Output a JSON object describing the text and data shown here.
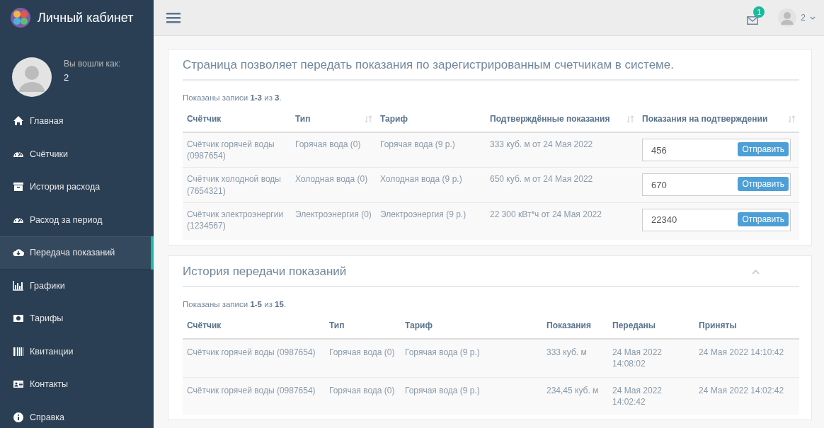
{
  "sidebar": {
    "title": "Личный кабинет",
    "profile": {
      "greeting": "Вы вошли как:",
      "user": "2"
    },
    "items": [
      {
        "label": "Главная",
        "kind": "home",
        "selected": false
      },
      {
        "label": "Счётчики",
        "kind": "gauge",
        "selected": false
      },
      {
        "label": "История расхода",
        "kind": "archive",
        "selected": false
      },
      {
        "label": "Расход за период",
        "kind": "gauge",
        "selected": false
      },
      {
        "label": "Передача показаний",
        "kind": "cloud",
        "selected": true
      },
      {
        "label": "Графики",
        "kind": "chart",
        "selected": false
      },
      {
        "label": "Тарифы",
        "kind": "money",
        "selected": false
      },
      {
        "label": "Квитанции",
        "kind": "barcode",
        "selected": false
      },
      {
        "label": "Контакты",
        "kind": "card",
        "selected": false
      },
      {
        "label": "Справка",
        "kind": "info",
        "selected": false
      }
    ]
  },
  "topbar": {
    "mail_count": "1",
    "user": "2"
  },
  "readings_panel": {
    "title": "Страница позволяет передать показания по зарегистрированным счетчикам в системе.",
    "summary": "Показаны записи **1-3** из **3**.",
    "columns": [
      {
        "label": "Счётчик",
        "sortable": false
      },
      {
        "label": "Тип",
        "sortable": true
      },
      {
        "label": "Тариф",
        "sortable": false
      },
      {
        "label": "Подтверждённые показания",
        "sortable": true
      },
      {
        "label": "Показания на подтверждении",
        "sortable": true
      }
    ],
    "rows": [
      {
        "meter": "Счётчик горячей воды (0987654)",
        "type": "Горячая вода (0)",
        "tariff": "Горячая вода (9 р.)",
        "confirmed": "333 куб. м от 24 Мая 2022",
        "pending": "456",
        "button": "Отправить"
      },
      {
        "meter": "Счётчик холодной воды (7654321)",
        "type": "Холодная вода (0)",
        "tariff": "Холодная вода (9 р.)",
        "confirmed": "650 куб. м от 24 Мая 2022",
        "pending": "670",
        "button": "Отправить"
      },
      {
        "meter": "Счётчик электроэнергии (1234567)",
        "type": "Электроэнергия (0)",
        "tariff": "Электроэнергия (9 р.)",
        "confirmed": "22 300 кВт*ч от 24 Мая 2022",
        "pending": "22340",
        "button": "Отправить"
      }
    ]
  },
  "history_panel": {
    "title": "История передачи показаний",
    "expanded": true,
    "summary": "Показаны записи **1-5** из **15**.",
    "columns": [
      "Счётчик",
      "Тип",
      "Тариф",
      "Показания",
      "Переданы",
      "Приняты"
    ],
    "rows": [
      [
        "Счётчик горячей воды (0987654)",
        "Горячая вода (0)",
        "Горячая вода (9 р.)",
        "333 куб. м",
        "24 Мая 2022 14:08:02",
        "24 Мая 2022 14:10:42"
      ],
      [
        "Счётчик горячей воды (0987654)",
        "Горячая вода (0)",
        "Горячая вода (9 р.)",
        "234,45 куб. м",
        "24 Мая 2022 14:02:42",
        "24 Мая 2022 14:02:42"
      ]
    ]
  }
}
